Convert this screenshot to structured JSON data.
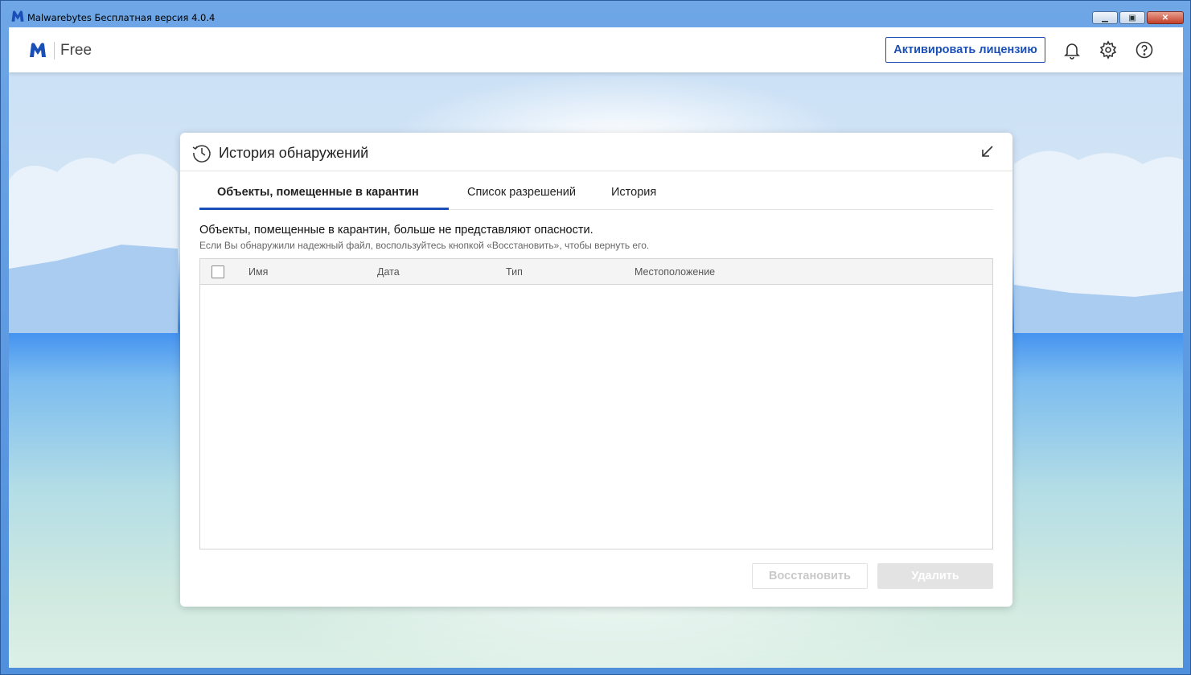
{
  "window": {
    "title": "Malwarebytes Бесплатная версия  4.0.4"
  },
  "header": {
    "product": "Free",
    "activate_label": "Активировать лицензию",
    "icons": [
      "bell-icon",
      "gear-icon",
      "help-icon"
    ]
  },
  "dialog": {
    "title": "История обнаружений",
    "tabs": [
      {
        "label": "Объекты, помещенные в карантин",
        "active": true
      },
      {
        "label": "Список разрешений",
        "active": false
      },
      {
        "label": "История",
        "active": false
      }
    ],
    "description": "Объекты, помещенные в карантин, больше не представляют опасности.",
    "hint": "Если Вы обнаружили надежный файл, воспользуйтесь кнопкой «Восстановить», чтобы вернуть его.",
    "columns": [
      "Имя",
      "Дата",
      "Тип",
      "Местоположение"
    ],
    "restore_label": "Восстановить",
    "delete_label": "Удалить"
  },
  "colors": {
    "accent": "#1a4fb8"
  }
}
